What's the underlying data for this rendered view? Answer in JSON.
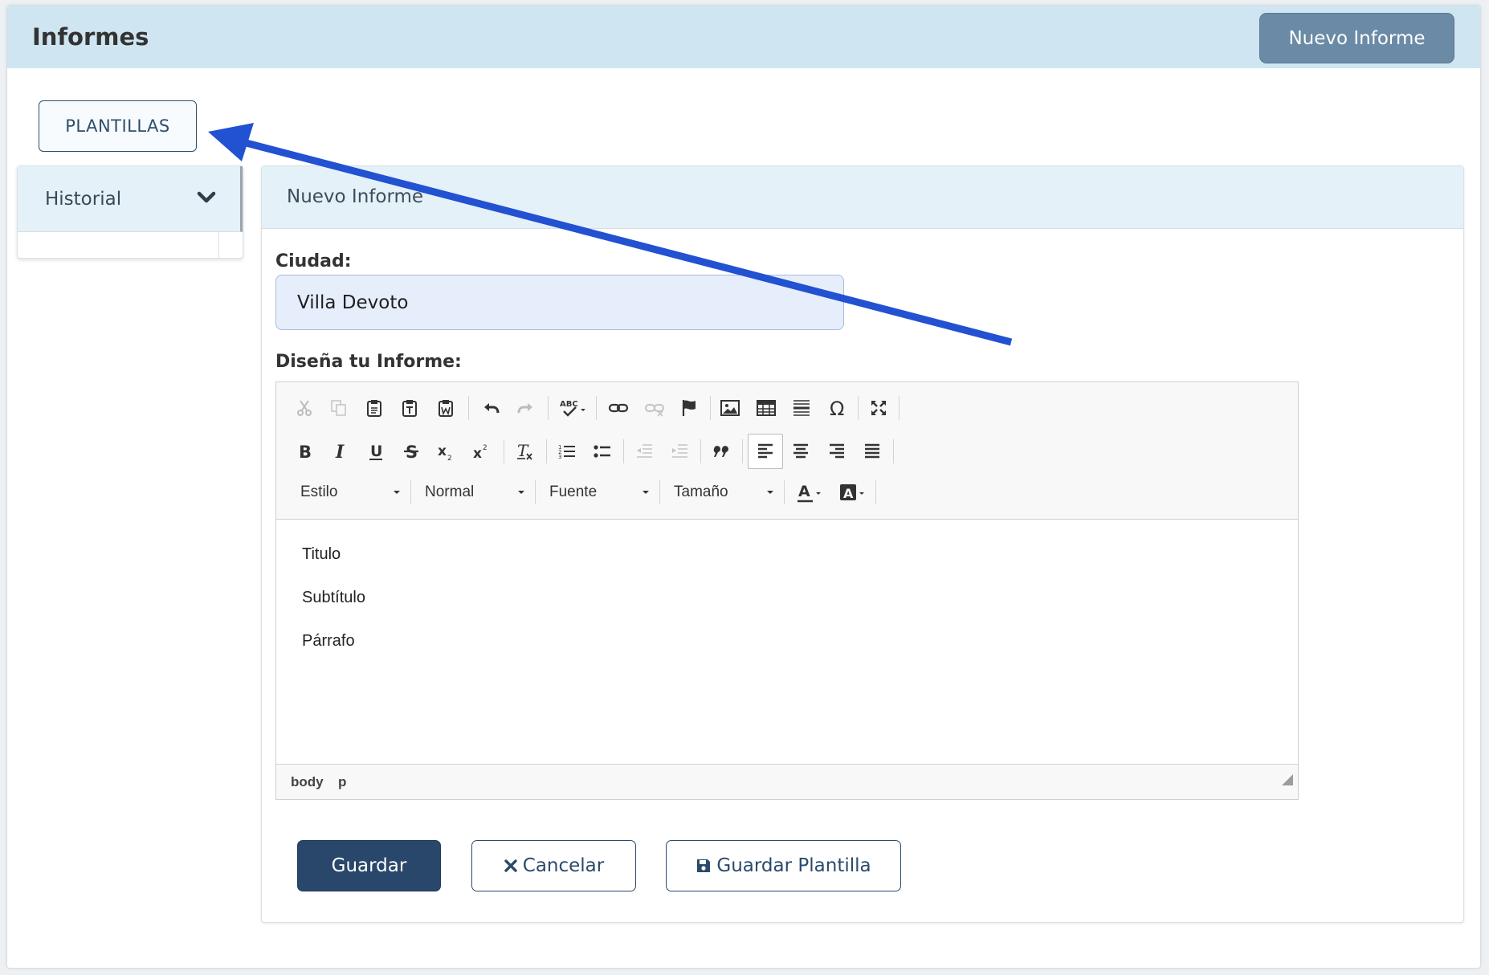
{
  "header": {
    "title": "Informes",
    "new_report_label": "Nuevo Informe"
  },
  "templates_button": "PLANTILLAS",
  "sidebar": {
    "history_label": "Historial"
  },
  "form": {
    "card_title": "Nuevo Informe",
    "city_label": "Ciudad:",
    "city_value": "Villa Devoto",
    "design_label": "Diseña tu Informe:",
    "editor": {
      "combos": {
        "style": "Estilo",
        "format": "Normal",
        "font": "Fuente",
        "size": "Tamaño"
      },
      "content": [
        "Titulo",
        "Subtítulo",
        "Párrafo"
      ],
      "path": [
        "body",
        "p"
      ]
    },
    "buttons": {
      "save": "Guardar",
      "cancel": "Cancelar",
      "save_template": "Guardar Plantilla"
    }
  },
  "colors": {
    "header_bg": "#cfe5f1",
    "primary": "#28476a",
    "new_report_bg": "#6a8aa5",
    "annotation_arrow": "#2251d1"
  }
}
